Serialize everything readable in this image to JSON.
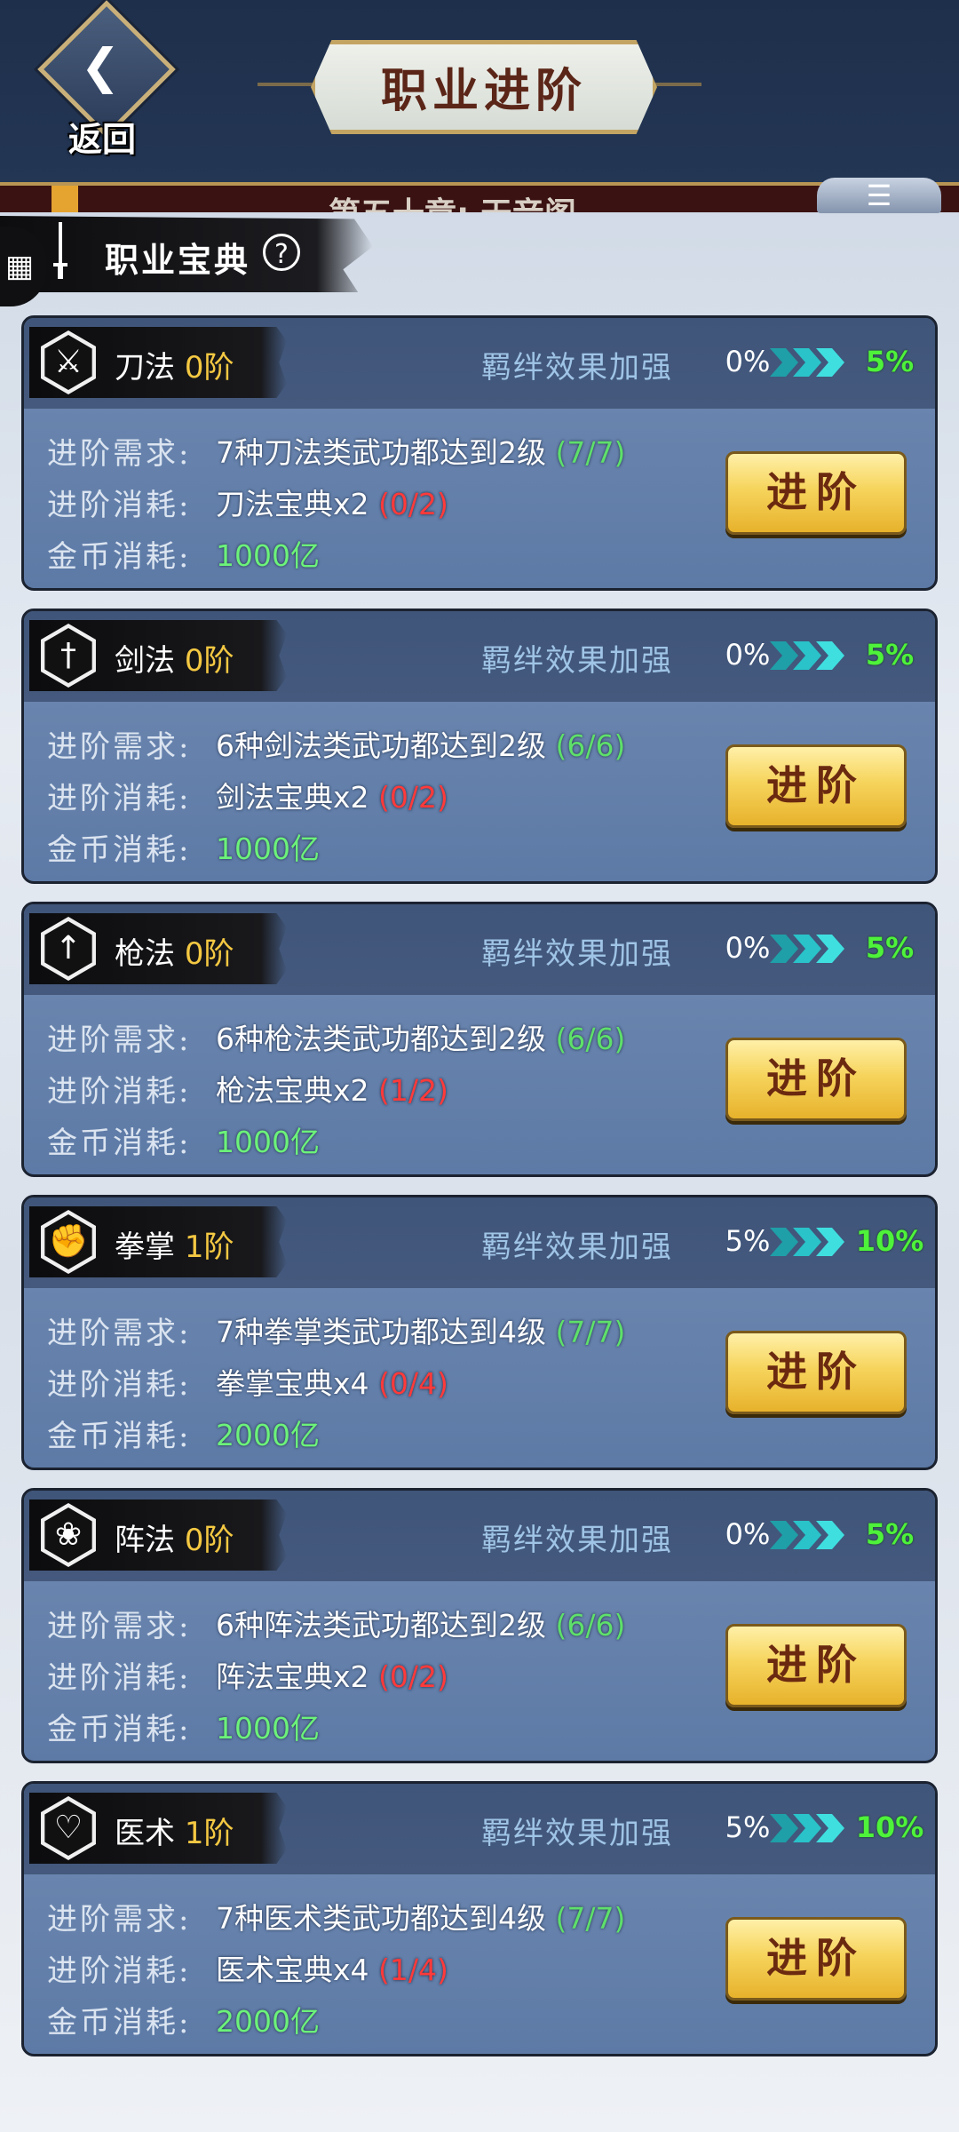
{
  "header": {
    "back_label": "返回",
    "title": "职业进阶",
    "chapter_text": "第五十章: 天音阁"
  },
  "section": {
    "title": "职业宝典",
    "help": "?"
  },
  "labels": {
    "bond": "羁绊效果加强",
    "requirement": "进阶需求:",
    "cost": "进阶消耗:",
    "gold": "金币消耗:",
    "button": "进阶"
  },
  "cards": [
    {
      "name": "刀法",
      "rank": "0阶",
      "icon": "crossed-blades-icon",
      "bond_cur": "0%",
      "bond_next": "5%",
      "req": "7种刀法类武功都达到2级",
      "req_prog": "(7/7)",
      "cost": "刀法宝典x2",
      "cost_prog": "(0/2)",
      "gold": "1000亿"
    },
    {
      "name": "剑法",
      "rank": "0阶",
      "icon": "sword-icon",
      "bond_cur": "0%",
      "bond_next": "5%",
      "req": "6种剑法类武功都达到2级",
      "req_prog": "(6/6)",
      "cost": "剑法宝典x2",
      "cost_prog": "(0/2)",
      "gold": "1000亿"
    },
    {
      "name": "枪法",
      "rank": "0阶",
      "icon": "spear-icon",
      "bond_cur": "0%",
      "bond_next": "5%",
      "req": "6种枪法类武功都达到2级",
      "req_prog": "(6/6)",
      "cost": "枪法宝典x2",
      "cost_prog": "(1/2)",
      "gold": "1000亿"
    },
    {
      "name": "拳掌",
      "rank": "1阶",
      "icon": "fist-icon",
      "bond_cur": "5%",
      "bond_next": "10%",
      "req": "7种拳掌类武功都达到4级",
      "req_prog": "(7/7)",
      "cost": "拳掌宝典x4",
      "cost_prog": "(0/4)",
      "gold": "2000亿"
    },
    {
      "name": "阵法",
      "rank": "0阶",
      "icon": "triquetra-icon",
      "bond_cur": "0%",
      "bond_next": "5%",
      "req": "6种阵法类武功都达到2级",
      "req_prog": "(6/6)",
      "cost": "阵法宝典x2",
      "cost_prog": "(0/2)",
      "gold": "1000亿"
    },
    {
      "name": "医术",
      "rank": "1阶",
      "icon": "heart-hand-icon",
      "bond_cur": "5%",
      "bond_next": "10%",
      "req": "7种医术类武功都达到4级",
      "req_prog": "(7/7)",
      "cost": "医术宝典x4",
      "cost_prog": "(1/4)",
      "gold": "2000亿"
    }
  ],
  "colors": {
    "header_bg": "#1e2f4b",
    "card_bg": "#5d7aa6",
    "rank_gold": "#f4c842",
    "progress_ok": "#5ee06a",
    "progress_bad": "#ff3a3a",
    "bond_next": "#4ef23a"
  }
}
